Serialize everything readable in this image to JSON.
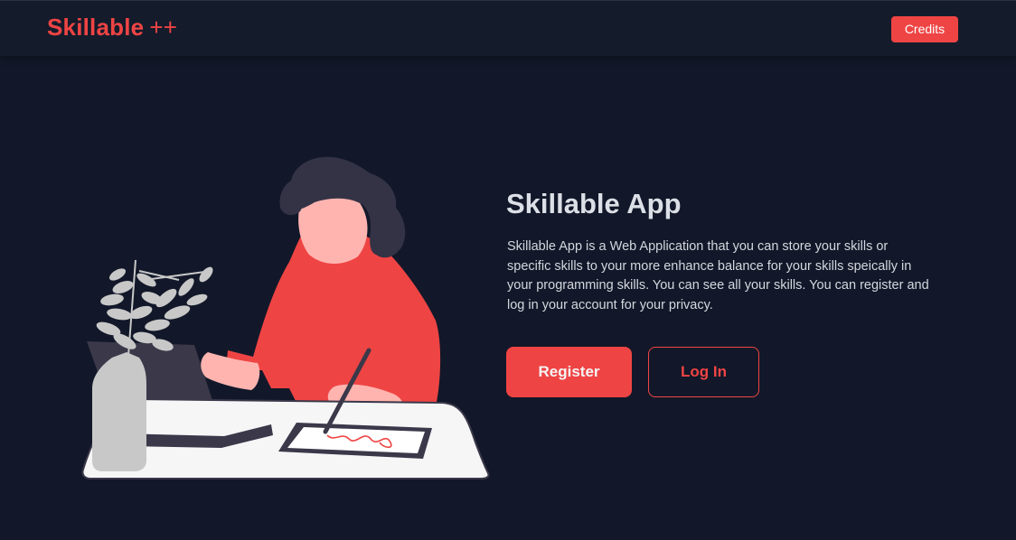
{
  "header": {
    "logo_main": "Skillable",
    "logo_suffix": "++",
    "credits_label": "Credits"
  },
  "hero": {
    "title": "Skillable App",
    "description": "Skillable App is a Web Application that you can store your skills or specific skills to your more enhance balance for your skills speically in your programming skills. You can see all your skills. You can register and log in your account for your privacy.",
    "register_label": "Register",
    "login_label": "Log In",
    "illustration": "woman-at-desk-with-laptop-tablet-and-plant"
  },
  "colors": {
    "background": "#121829",
    "header_bg": "#141b2b",
    "accent": "#ef4444",
    "title_text": "#dcdfe6",
    "body_text": "#d4d7de"
  }
}
